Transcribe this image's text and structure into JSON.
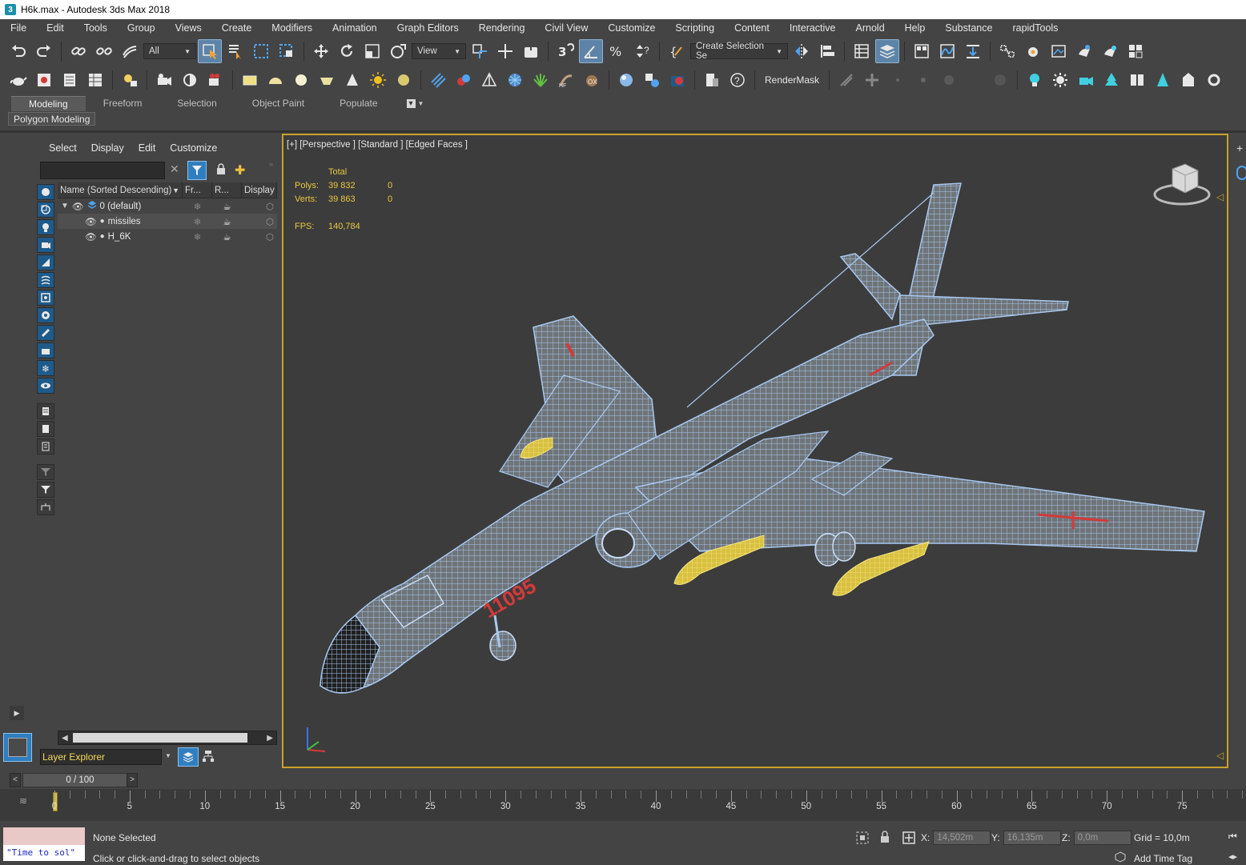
{
  "window": {
    "title": "H6k.max - Autodesk 3ds Max 2018",
    "app_badge": "3"
  },
  "menu": [
    "File",
    "Edit",
    "Tools",
    "Group",
    "Views",
    "Create",
    "Modifiers",
    "Animation",
    "Graph Editors",
    "Rendering",
    "Civil View",
    "Customize",
    "Scripting",
    "Content",
    "Interactive",
    "Arnold",
    "Help",
    "Substance",
    "rapidTools"
  ],
  "toolbar": {
    "filter_value": "All",
    "view_value": "View",
    "selection_set_value": "Create Selection Se",
    "rendermask_label": "RenderMask"
  },
  "ribbon": {
    "tabs": [
      "Modeling",
      "Freeform",
      "Selection",
      "Object Paint",
      "Populate"
    ],
    "active_tab": "Modeling",
    "sub_label": "Polygon Modeling"
  },
  "scene_explorer": {
    "menu": [
      "Select",
      "Display",
      "Edit",
      "Customize"
    ],
    "columns": [
      "Name (Sorted Descending)",
      "Fr...",
      "R...",
      "Display a"
    ],
    "rows": [
      {
        "name": "0 (default)"
      },
      {
        "name": "missiles"
      },
      {
        "name": "H_6K"
      }
    ],
    "footer_label": "Layer Explorer"
  },
  "viewport": {
    "label": "[+] [Perspective ] [Standard ] [Edged Faces ]",
    "stats": {
      "header": "Total",
      "polys_label": "Polys:",
      "polys_total": "39 832",
      "polys_sel": "0",
      "verts_label": "Verts:",
      "verts_total": "39 863",
      "verts_sel": "0",
      "fps_label": "FPS:",
      "fps_value": "140,784"
    },
    "fuselage_number": "11095",
    "colors": {
      "border": "#c9a12a",
      "wire": "#9bc0ee",
      "missile": "#e8d24a",
      "stats": "#e8c840"
    }
  },
  "timeline": {
    "frame_display": "0 / 100",
    "tick_labels": [
      "0",
      "5",
      "10",
      "15",
      "20",
      "25",
      "30",
      "35",
      "40",
      "45",
      "50",
      "55",
      "60",
      "65",
      "70",
      "75"
    ]
  },
  "status": {
    "selection": "None Selected",
    "prompt": "Click or click-and-drag to select objects",
    "maxscript_text": "\"Time to sol\"",
    "x_label": "X:",
    "x_value": "14,502m",
    "y_label": "Y:",
    "y_value": "16,135m",
    "z_label": "Z:",
    "z_value": "0,0m",
    "grid": "Grid = 10,0m",
    "add_time_tag": "Add Time Tag"
  }
}
